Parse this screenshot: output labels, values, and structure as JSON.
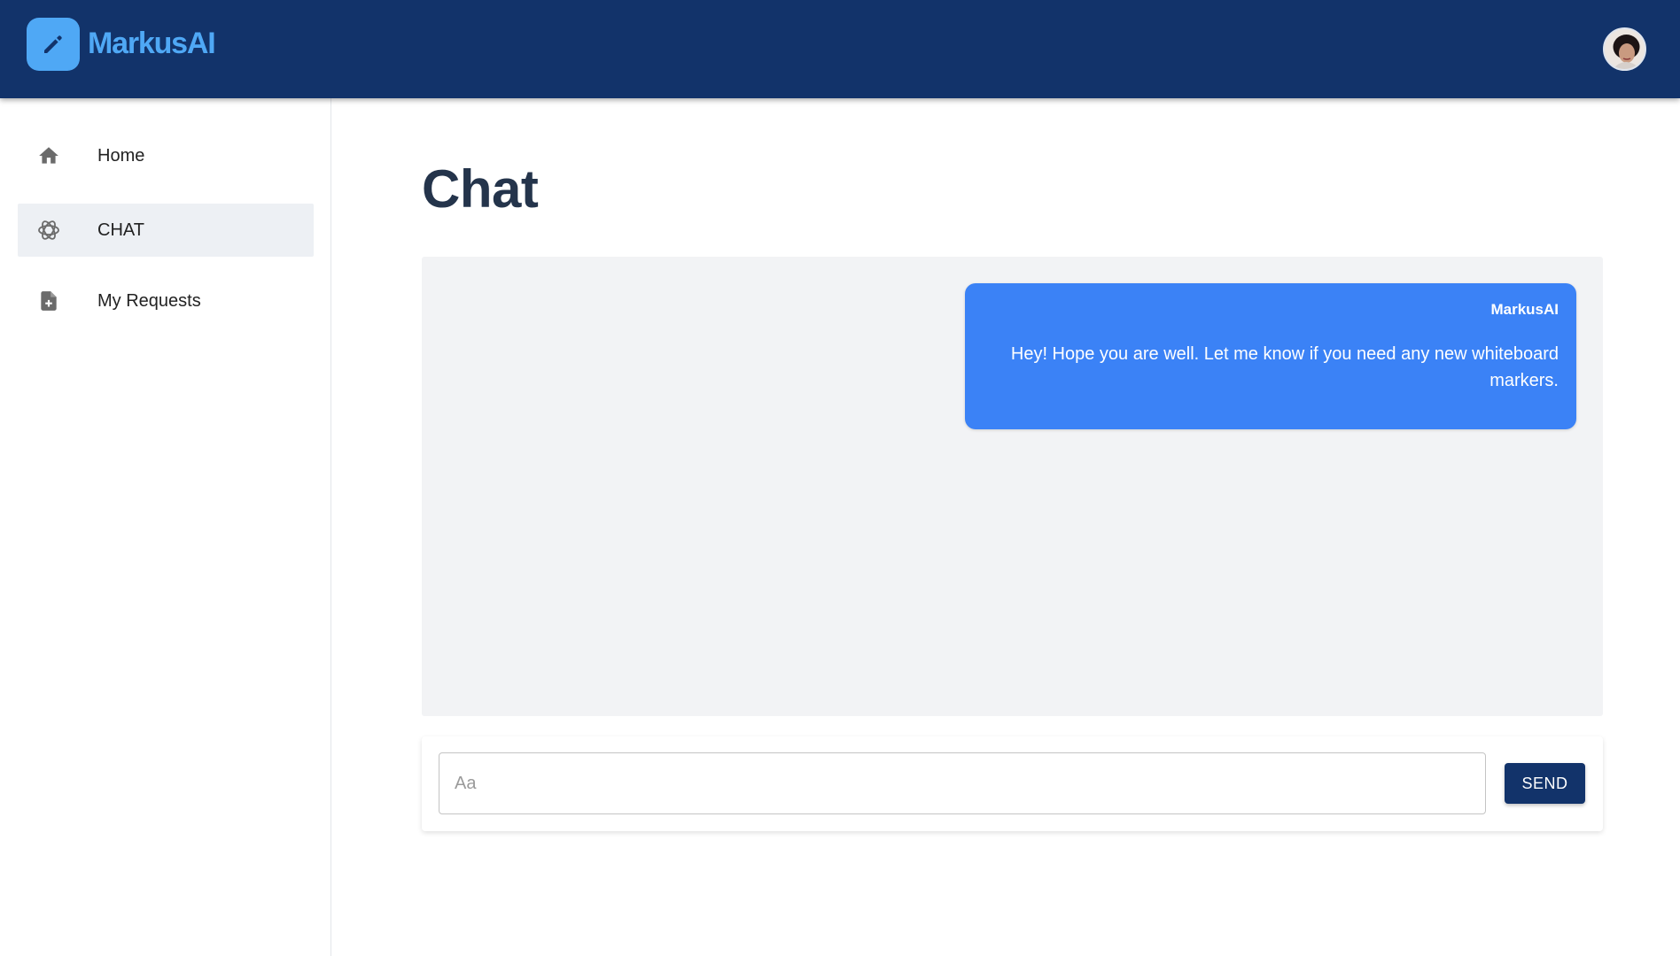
{
  "app": {
    "name": "MarkusAI",
    "logo_icon": "pencil-icon",
    "avatar_icon": "user-avatar"
  },
  "colors": {
    "appbar": "#12336a",
    "brand": "#4fa8f5",
    "bubble": "#3b82f6",
    "chat_background": "#f2f3f5",
    "active_nav": "#edf0f4",
    "title": "#24344b"
  },
  "sidebar": {
    "items": [
      {
        "label": "Home",
        "icon": "home-icon",
        "active": false
      },
      {
        "label": "CHAT",
        "icon": "openai-icon",
        "active": true
      },
      {
        "label": "My Requests",
        "icon": "file-add-icon",
        "active": false
      }
    ]
  },
  "main": {
    "title": "Chat",
    "messages": [
      {
        "sender": "MarkusAI",
        "text": "Hey! Hope you are well. Let me know if you need any new whiteboard markers."
      }
    ],
    "composer": {
      "placeholder": "Aa",
      "value": "",
      "send_label": "SEND"
    }
  }
}
